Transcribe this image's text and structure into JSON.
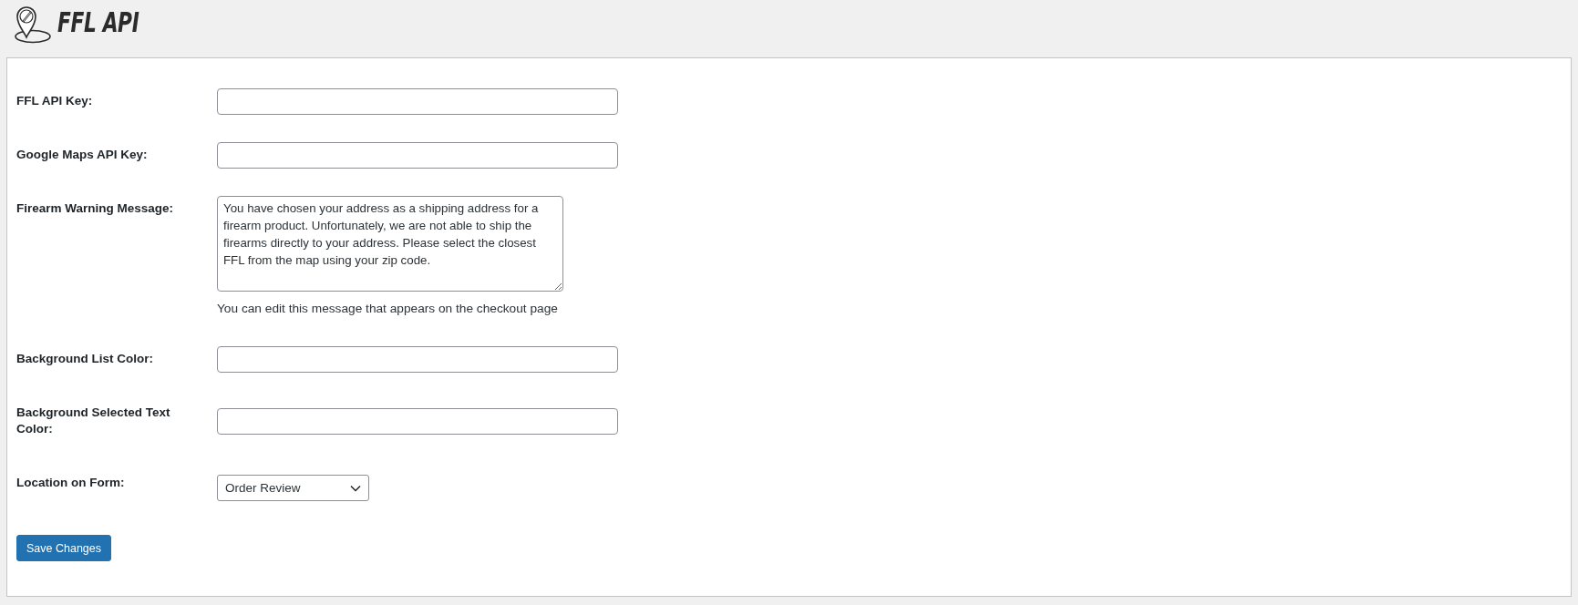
{
  "header": {
    "logo_text": "FFL API"
  },
  "fields": [
    {
      "kind": "text",
      "label": "FFL API Key:"
    },
    {
      "kind": "text",
      "label": "Google Maps API Key:"
    },
    {
      "kind": "textarea",
      "label": "Firearm Warning Message:",
      "value": "You have chosen your address as a shipping address for a firearm product. Unfortunately, we are not able to ship the firearms directly to your address. Please select the closest FFL from the map using your zip code.",
      "description": "You can edit this message that appears on the checkout page"
    },
    {
      "kind": "text",
      "label": "Background List Color:"
    },
    {
      "kind": "text",
      "label": "Background Selected Text Color:"
    },
    {
      "kind": "select",
      "label": "Location on Form:",
      "value": "Order Review"
    }
  ],
  "buttons": [
    {
      "label": "Save Changes"
    }
  ]
}
